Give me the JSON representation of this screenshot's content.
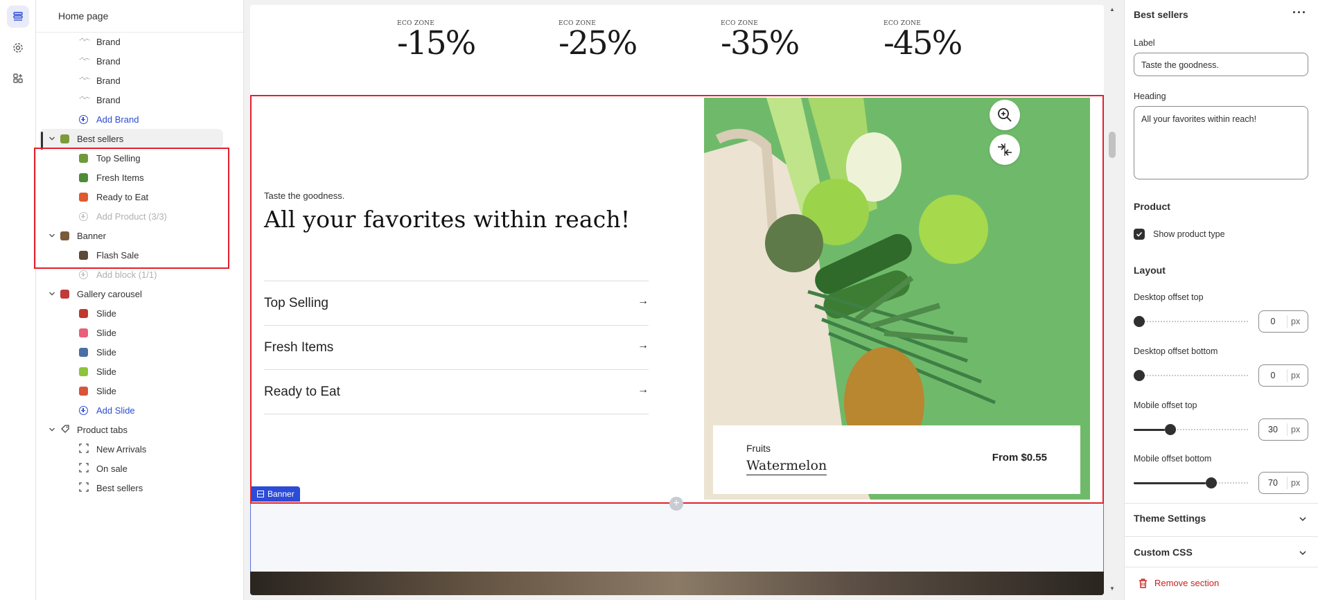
{
  "tree": {
    "title": "Home page",
    "rows": [
      {
        "label": "Brand",
        "kind": "block",
        "icon": "brand-logo-icon"
      },
      {
        "label": "Brand",
        "kind": "block",
        "icon": "brand-logo-icon"
      },
      {
        "label": "Brand",
        "kind": "block",
        "icon": "brand-logo-icon"
      },
      {
        "label": "Brand",
        "kind": "block",
        "icon": "brand-logo-icon"
      },
      {
        "label": "Add Brand",
        "kind": "add"
      },
      {
        "label": "Best sellers",
        "kind": "section",
        "icon": "best-sellers-thumb-icon",
        "selected": true
      },
      {
        "label": "Top Selling",
        "kind": "block",
        "icon": "top-selling-thumb-icon"
      },
      {
        "label": "Fresh Items",
        "kind": "block",
        "icon": "fresh-items-thumb-icon"
      },
      {
        "label": "Ready to Eat",
        "kind": "block",
        "icon": "ready-to-eat-thumb-icon"
      },
      {
        "label": "Add Product (3/3)",
        "kind": "disabled"
      },
      {
        "label": "Banner",
        "kind": "section",
        "icon": "banner-thumb-icon"
      },
      {
        "label": "Flash Sale",
        "kind": "block",
        "icon": "flash-sale-thumb-icon"
      },
      {
        "label": "Add block (1/1)",
        "kind": "disabled"
      },
      {
        "label": "Gallery carousel",
        "kind": "section",
        "icon": "gallery-thumb-icon"
      },
      {
        "label": "Slide",
        "kind": "block",
        "icon": "slide-thumb-icon"
      },
      {
        "label": "Slide",
        "kind": "block",
        "icon": "slide-thumb-icon"
      },
      {
        "label": "Slide",
        "kind": "block",
        "icon": "slide-thumb-icon"
      },
      {
        "label": "Slide",
        "kind": "block",
        "icon": "slide-thumb-icon"
      },
      {
        "label": "Slide",
        "kind": "block",
        "icon": "slide-thumb-icon"
      },
      {
        "label": "Add Slide",
        "kind": "add"
      },
      {
        "label": "Product tabs",
        "kind": "section",
        "icon": "tag-icon"
      },
      {
        "label": "New Arrivals",
        "kind": "block",
        "icon": "block-frame-icon"
      },
      {
        "label": "On sale",
        "kind": "block",
        "icon": "block-frame-icon"
      },
      {
        "label": "Best sellers",
        "kind": "block",
        "icon": "block-frame-icon"
      }
    ]
  },
  "preview": {
    "promos": [
      {
        "label": "ECO ZONE",
        "value": "-15%"
      },
      {
        "label": "ECO ZONE",
        "value": "-25%"
      },
      {
        "label": "ECO ZONE",
        "value": "-35%"
      },
      {
        "label": "ECO ZONE",
        "value": "-45%"
      }
    ],
    "banner": {
      "kicker": "Taste the goodness.",
      "heading": "All your favorites within reach!",
      "links": [
        "Top Selling",
        "Fresh Items",
        "Ready to Eat"
      ],
      "arrow": "→",
      "card": {
        "category": "Fruits",
        "name": "Watermelon",
        "price": "From $0.55"
      },
      "tag": "Banner"
    }
  },
  "settings": {
    "title": "Best sellers",
    "more": "···",
    "label_field": {
      "label": "Label",
      "value": "Taste the goodness."
    },
    "heading_field": {
      "label": "Heading",
      "value": "All your favorites within reach!"
    },
    "product_section": "Product",
    "show_product_type": "Show product type",
    "layout_section": "Layout",
    "offsets": [
      {
        "label": "Desktop offset top",
        "value": "0",
        "unit": "px",
        "fraction": 0.0
      },
      {
        "label": "Desktop offset bottom",
        "value": "0",
        "unit": "px",
        "fraction": 0.0
      },
      {
        "label": "Mobile offset top",
        "value": "30",
        "unit": "px",
        "fraction": 0.3
      },
      {
        "label": "Mobile offset bottom",
        "value": "70",
        "unit": "px",
        "fraction": 0.7
      }
    ],
    "theme_settings": "Theme Settings",
    "custom_css": "Custom CSS",
    "remove": "Remove section"
  },
  "colors": {
    "accent": "#2c4bd6",
    "highlight": "#e2202e",
    "danger": "#c5221f",
    "dark": "#303030"
  }
}
